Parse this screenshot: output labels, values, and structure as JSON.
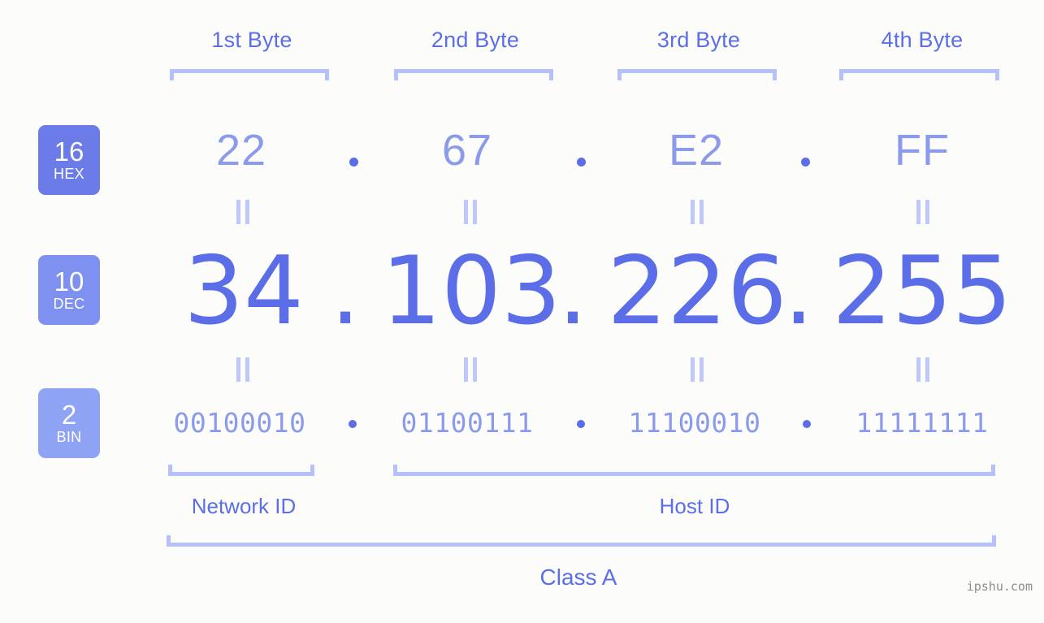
{
  "background_color": "#fcfdfa",
  "accent_color": "#5b6ee8",
  "accent_light_color": "#8b9aea",
  "bracket_color": "#b6c0fa",
  "byte_headers": [
    {
      "label": "1st Byte"
    },
    {
      "label": "2nd Byte"
    },
    {
      "label": "3rd Byte"
    },
    {
      "label": "4th Byte"
    }
  ],
  "rows": {
    "hex": {
      "base_number": "16",
      "base_name": "HEX",
      "badge_color": "#6b7ce8",
      "values": [
        "22",
        "67",
        "E2",
        "FF"
      ],
      "separator": "."
    },
    "dec": {
      "base_number": "10",
      "base_name": "DEC",
      "badge_color": "#7f91f0",
      "values": [
        "34",
        "103",
        "226",
        "255"
      ],
      "separator": "."
    },
    "bin": {
      "base_number": "2",
      "base_name": "BIN",
      "badge_color": "#8fa3f5",
      "values": [
        "00100010",
        "01100111",
        "11100010",
        "11111111"
      ],
      "separator": "."
    }
  },
  "equals_glyph": "=",
  "id_sections": [
    {
      "label": "Network ID"
    },
    {
      "label": "Host ID"
    }
  ],
  "class_label": "Class A",
  "watermark": "ipshu.com"
}
